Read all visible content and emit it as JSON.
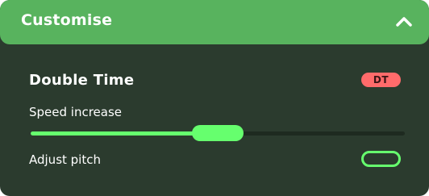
{
  "header": {
    "title": "Customise",
    "collapse_icon": "chevron-up-icon"
  },
  "mod": {
    "title": "Double Time",
    "badge": "DT"
  },
  "speed_slider": {
    "label": "Speed increase",
    "value_fraction": 0.5
  },
  "adjust_pitch": {
    "label": "Adjust pitch",
    "enabled": false
  },
  "colors": {
    "panel_bg": "#2b3b2e",
    "header_bg": "#58b35e",
    "accent": "#66ff6e",
    "badge_bg": "#ff6b6b",
    "track_bg": "#1e2a20"
  }
}
